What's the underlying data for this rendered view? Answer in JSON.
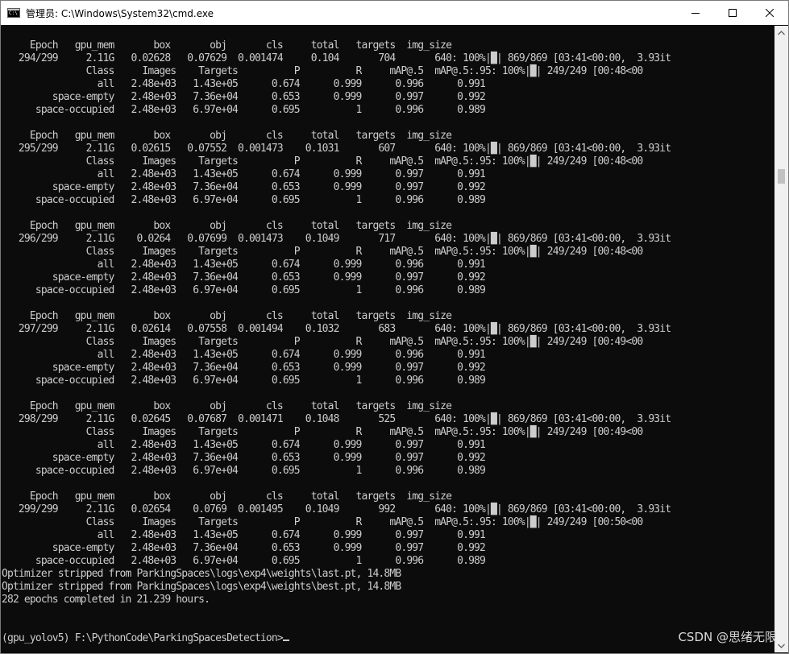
{
  "window": {
    "title": "管理员: C:\\Windows\\System32\\cmd.exe",
    "app_icon": "cmd-console-icon",
    "controls": [
      "minimize-icon",
      "maximize-icon",
      "close-icon"
    ]
  },
  "console": {
    "lines": [
      "     Epoch   gpu_mem       box       obj       cls     total   targets  img_size",
      "   294/299     2.11G   0.02628   0.07629  0.001474     0.104       704       640: 100%|█| 869/869 [03:41<00:00,  3.93it",
      "               Class     Images    Targets          P          R     mAP@.5  mAP@.5:.95: 100%|█| 249/249 [00:48<00",
      "                 all   2.48e+03   1.43e+05      0.674      0.999      0.996      0.991",
      "         space-empty   2.48e+03   7.36e+04      0.653      0.999      0.997      0.992",
      "      space-occupied   2.48e+03   6.97e+04      0.695          1      0.996      0.989",
      "",
      "     Epoch   gpu_mem       box       obj       cls     total   targets  img_size",
      "   295/299     2.11G   0.02615   0.07552  0.001473    0.1031       607       640: 100%|█| 869/869 [03:41<00:00,  3.93it",
      "               Class     Images    Targets          P          R     mAP@.5  mAP@.5:.95: 100%|█| 249/249 [00:48<00",
      "                 all   2.48e+03   1.43e+05      0.674      0.999      0.997      0.991",
      "         space-empty   2.48e+03   7.36e+04      0.653      0.999      0.997      0.992",
      "      space-occupied   2.48e+03   6.97e+04      0.695          1      0.996      0.989",
      "",
      "     Epoch   gpu_mem       box       obj       cls     total   targets  img_size",
      "   296/299     2.11G    0.0264   0.07699  0.001473    0.1049       717       640: 100%|█| 869/869 [03:41<00:00,  3.93it",
      "               Class     Images    Targets          P          R     mAP@.5  mAP@.5:.95: 100%|█| 249/249 [00:48<00",
      "                 all   2.48e+03   1.43e+05      0.674      0.999      0.996      0.991",
      "         space-empty   2.48e+03   7.36e+04      0.653      0.999      0.997      0.992",
      "      space-occupied   2.48e+03   6.97e+04      0.695          1      0.996      0.989",
      "",
      "     Epoch   gpu_mem       box       obj       cls     total   targets  img_size",
      "   297/299     2.11G   0.02614   0.07558  0.001494    0.1032       683       640: 100%|█| 869/869 [03:41<00:00,  3.93it",
      "               Class     Images    Targets          P          R     mAP@.5  mAP@.5:.95: 100%|█| 249/249 [00:49<00",
      "                 all   2.48e+03   1.43e+05      0.674      0.999      0.996      0.991",
      "         space-empty   2.48e+03   7.36e+04      0.653      0.999      0.997      0.992",
      "      space-occupied   2.48e+03   6.97e+04      0.695          1      0.996      0.989",
      "",
      "     Epoch   gpu_mem       box       obj       cls     total   targets  img_size",
      "   298/299     2.11G   0.02645   0.07687  0.001471    0.1048       525       640: 100%|█| 869/869 [03:41<00:00,  3.93it",
      "               Class     Images    Targets          P          R     mAP@.5  mAP@.5:.95: 100%|█| 249/249 [00:49<00",
      "                 all   2.48e+03   1.43e+05      0.674      0.999      0.997      0.991",
      "         space-empty   2.48e+03   7.36e+04      0.653      0.999      0.997      0.992",
      "      space-occupied   2.48e+03   6.97e+04      0.695          1      0.996      0.989",
      "",
      "     Epoch   gpu_mem       box       obj       cls     total   targets  img_size",
      "   299/299     2.11G   0.02654    0.0769  0.001495    0.1049       992       640: 100%|█| 869/869 [03:41<00:00,  3.93it",
      "               Class     Images    Targets          P          R     mAP@.5  mAP@.5:.95: 100%|█| 249/249 [00:50<00",
      "                 all   2.48e+03   1.43e+05      0.674      0.999      0.997      0.991",
      "         space-empty   2.48e+03   7.36e+04      0.653      0.999      0.997      0.992",
      "      space-occupied   2.48e+03   6.97e+04      0.695          1      0.996      0.989",
      "Optimizer stripped from ParkingSpaces\\logs\\exp4\\weights\\last.pt, 14.8MB",
      "Optimizer stripped from ParkingSpaces\\logs\\exp4\\weights\\best.pt, 14.8MB",
      "282 epochs completed in 21.239 hours.",
      "",
      "",
      "(gpu_yolov5) F:\\PythonCode\\ParkingSpacesDetection>"
    ]
  },
  "watermark": "CSDN @思绪无限",
  "colors": {
    "console_bg": "#0c0c0c",
    "console_fg": "#cccccc",
    "titlebar_bg": "#ffffff",
    "scrollbar_bg": "#f0f0f0"
  }
}
